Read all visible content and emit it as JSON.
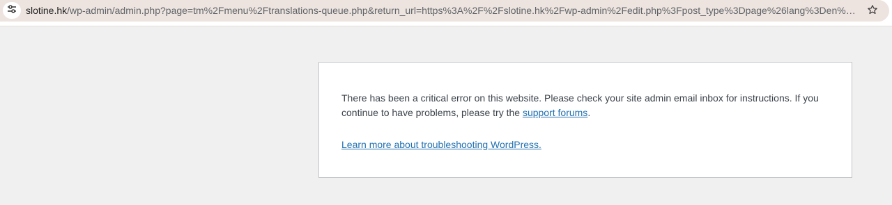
{
  "browser": {
    "url_host": "slotine.hk",
    "url_path": "/wp-admin/admin.php?page=tm%2Fmenu%2Ftranslations-queue.php&return_url=https%3A%2F%2Fslotine.hk%2Fwp-admin%2Fedit.php%3Fpost_type%3Dpage%26lang%3Den%26r...",
    "site_info_icon": "tune-icon",
    "bookmark_icon": "star-icon"
  },
  "error": {
    "message_before_link": "There has been a critical error on this website. Please check your site admin email inbox for instructions. If you continue to have problems, please try the ",
    "support_link": "support forums",
    "message_after_link": ".",
    "learn_more_link": "Learn more about troubleshooting WordPress."
  },
  "colors": {
    "page_background": "#f0f0f1",
    "omnibox_background": "#ede4df",
    "link": "#2271b1",
    "text": "#3c434a",
    "box_border": "#c3c4c7"
  }
}
